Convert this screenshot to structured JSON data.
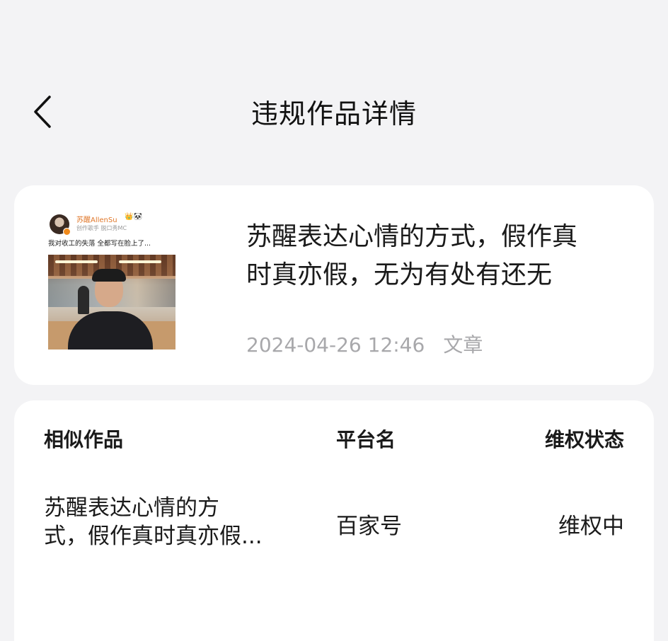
{
  "header": {
    "title": "违规作品详情",
    "back_icon": "chevron-left-icon"
  },
  "work": {
    "thumbnail": {
      "username": "苏醒AllenSu",
      "user_icons": "👑🐼",
      "meta": "创作歌手 脱口秀MC",
      "caption": "我对收工的失落 全都写在脸上了..."
    },
    "title_line1": "苏醒表达心情的方式，假作真",
    "title_line2": "时真亦假，无为有处有还无",
    "datetime": "2024-04-26 12:46",
    "type": "文章"
  },
  "similar": {
    "headers": {
      "title": "相似作品",
      "platform": "平台名",
      "status": "维权状态"
    },
    "rows": [
      {
        "title_line1": "苏醒表达心情的方",
        "title_line2": "式，假作真时真亦假...",
        "platform": "百家号",
        "status": "维权中"
      }
    ]
  },
  "colors": {
    "background": "#f3f3f5",
    "card": "#ffffff",
    "text_primary": "#1a1a1a",
    "text_muted": "#a8a8ab",
    "username_accent": "#e0772a"
  }
}
